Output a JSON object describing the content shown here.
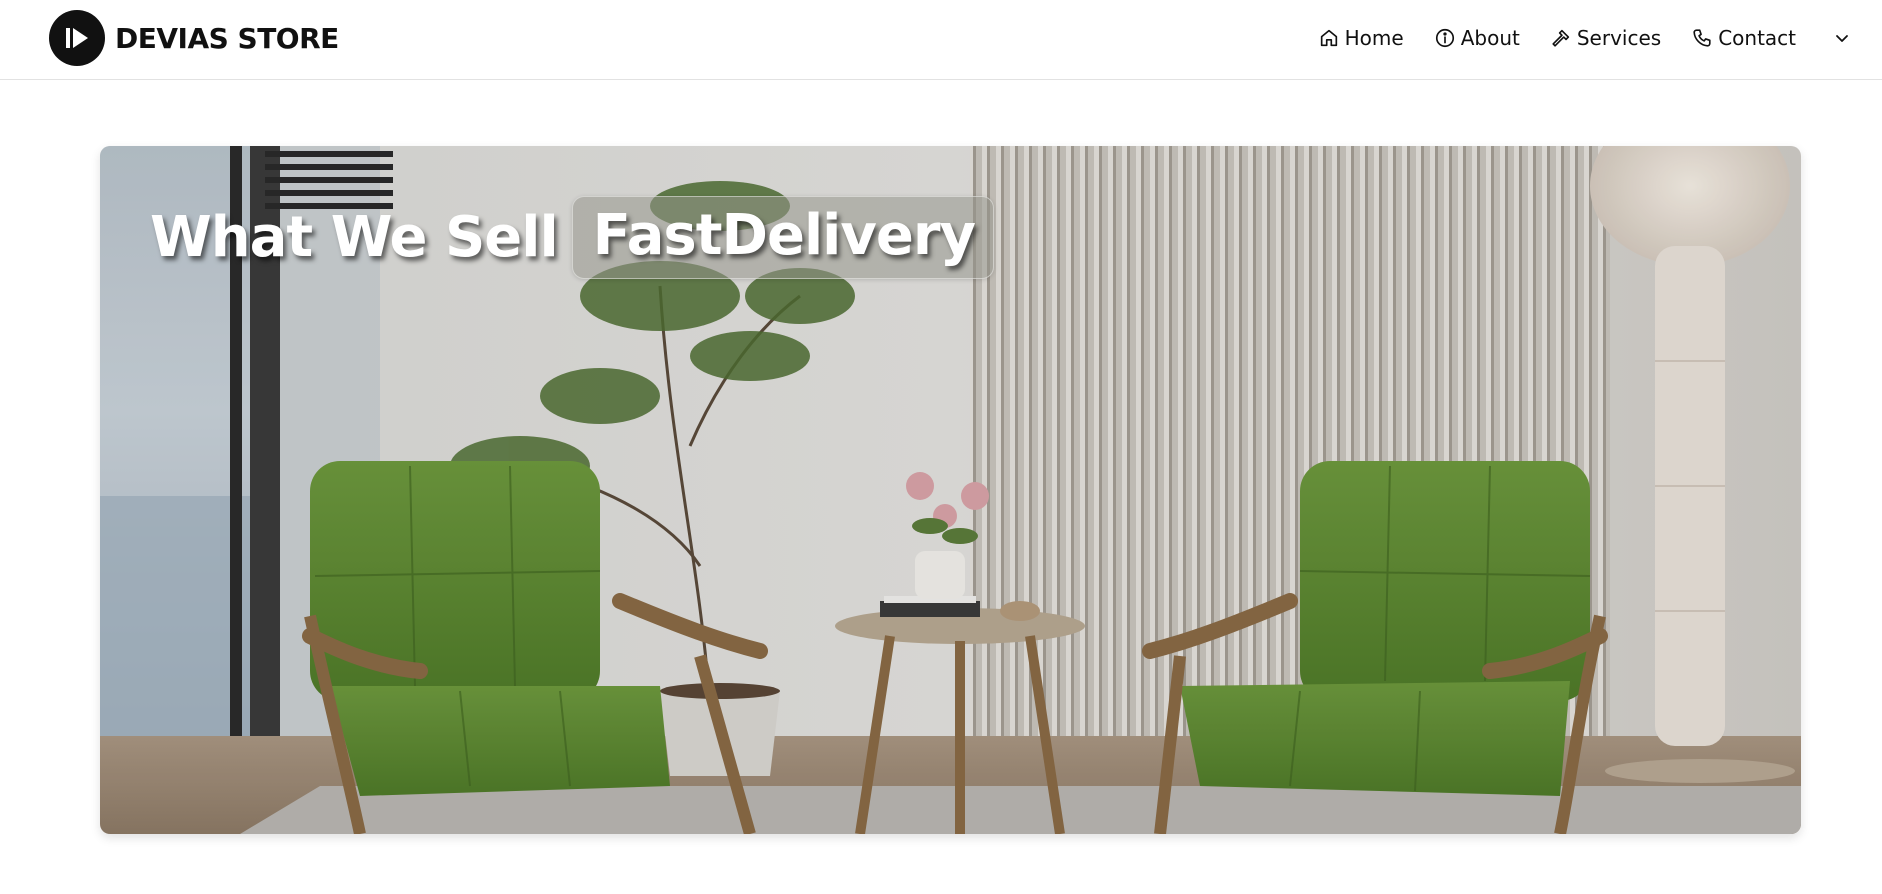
{
  "brand": {
    "name": "DEVIAS STORE",
    "logo_icon": "play-logo-icon"
  },
  "nav": {
    "items": [
      {
        "label": "Home",
        "icon": "home-icon"
      },
      {
        "label": "About",
        "icon": "info-icon"
      },
      {
        "label": "Services",
        "icon": "hammer-icon"
      },
      {
        "label": "Contact",
        "icon": "phone-icon"
      }
    ],
    "more_icon": "chevron-down-icon"
  },
  "hero": {
    "static_text": "What We Sell",
    "rotating_text": "FastDelivery"
  },
  "colors": {
    "text": "#111111",
    "header_border": "#e2e2e2",
    "chair_green": "#5f8a32",
    "wood": "#8a6a45"
  }
}
